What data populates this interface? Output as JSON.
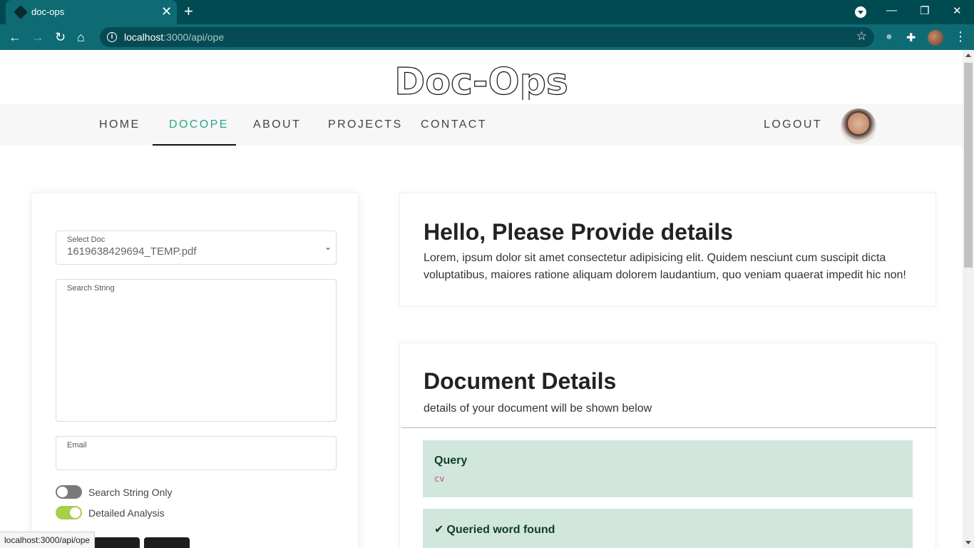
{
  "browser": {
    "tab_title": "doc-ops",
    "url_host": "localhost",
    "url_path": ":3000/api/ope"
  },
  "site": {
    "logo_text": "Doc-Ops",
    "nav": [
      {
        "label": "HOME",
        "active": false
      },
      {
        "label": "DOCOPE",
        "active": true
      },
      {
        "label": "ABOUT",
        "active": false
      },
      {
        "label": "PROJECTS",
        "active": false
      },
      {
        "label": "CONTACT",
        "active": false
      }
    ],
    "logout_label": "LOGOUT"
  },
  "form": {
    "select_doc_label": "Select Doc",
    "select_doc_value": "1619638429694_TEMP.pdf",
    "search_string_label": "Search String",
    "search_string_value": "",
    "email_label": "Email",
    "email_value": "",
    "toggles": [
      {
        "label": "Search String Only",
        "checked": false
      },
      {
        "label": "Detailed Analysis",
        "checked": true
      }
    ]
  },
  "intro": {
    "title": "Hello, Please Provide details",
    "text": "Lorem, ipsum dolor sit amet consectetur adipisicing elit. Quidem nesciunt cum suscipit dicta voluptatibus, maiores ratione aliquam dolorem laudantium, quo veniam quaerat impedit hic non!"
  },
  "details": {
    "title": "Document Details",
    "subtitle": "details of your document will be shown below",
    "query_heading": "Query",
    "query_value": "cv",
    "found_heading": "Queried word found"
  },
  "status_url": "localhost:3000/api/ope",
  "colors": {
    "accent": "#2aa58a",
    "toggle_on": "#a6cf4a",
    "toggle_off": "#7a7a7a",
    "alert_bg": "#d1e7dd",
    "chrome_dark": "#004a52",
    "chrome_toolbar": "#0e6b73"
  }
}
